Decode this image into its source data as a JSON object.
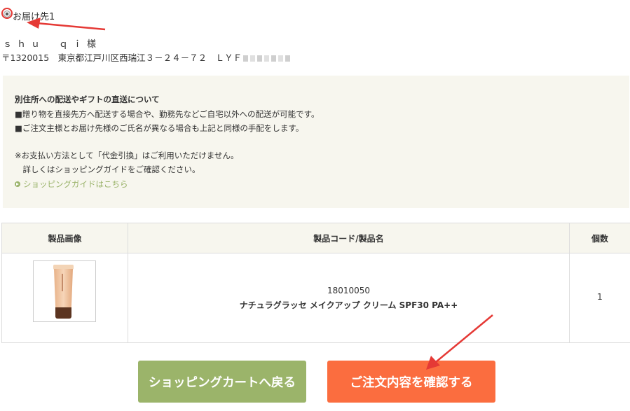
{
  "address": {
    "label": "お届け先1",
    "name": "ｓｈｕ　ｑｉ様",
    "address_line": "〒1320015　東京都江戸川区西瑞江３－２４－７２　ＬＹＦ"
  },
  "notice": {
    "title": "別住所への配送やギフトの直送について",
    "line1": "■贈り物を直接先方へ配送する場合や、勤務先などご自宅以外への配送が可能です。",
    "line2": "■ご注文主様とお届け先様のご氏名が異なる場合も上記と同様の手配をします。",
    "note1": "※お支払い方法として「代金引換」はご利用いただけません。",
    "note2": "　詳しくはショッピングガイドをご確認ください。",
    "link": "ショッピングガイドはこちら"
  },
  "table": {
    "headers": {
      "image": "製品画像",
      "code_name": "製品コード/製品名",
      "qty": "個数"
    },
    "rows": [
      {
        "code": "18010050",
        "name": "ナチュラグラッセ メイクアップ クリーム SPF30 PA++",
        "qty": "1"
      }
    ]
  },
  "buttons": {
    "back": "ショッピングカートへ戻る",
    "confirm": "ご注文内容を確認する"
  },
  "colors": {
    "accent_green": "#9bb46a",
    "accent_orange": "#fb6d3f",
    "notice_bg": "#f7f6ee",
    "annotation_red": "#e53935"
  }
}
